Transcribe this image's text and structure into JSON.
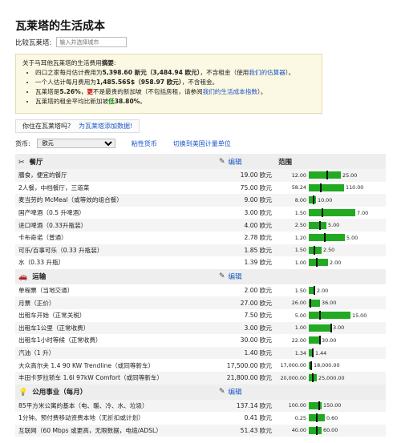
{
  "title": "瓦莱塔的生活成本",
  "compare": {
    "label": "比较瓦莱塔:",
    "placeholder": "输入并选择城市"
  },
  "summary": {
    "intro_a": "关于马耳他瓦莱塔的生活费用",
    "intro_b": "摘要",
    "intro_c": ":",
    "items": [
      {
        "a": "四口之家每月估计费用为",
        "b": "5,398.60 新元（3,484.94 欧元）",
        "c": "，不含租金（使用",
        "d": "我们的估算器",
        "e": "）。"
      },
      {
        "a": "一个人估计每月费用为",
        "b": "1,485.56S$（958.97 欧元）",
        "c": "，不含租金。",
        "d": "",
        "e": ""
      },
      {
        "a": "瓦莱塔是",
        "b": "5.26%",
        "c": "，",
        "d": "更",
        "e": "不是最贵的新加坡（不包括房租，请参阅",
        "f": "我们的生活成本指数",
        "g": "）。"
      },
      {
        "a": "瓦莱塔的租金平均比新加坡",
        "b": "低",
        "c": "38.80%",
        "d": "。"
      }
    ]
  },
  "live": {
    "q": "你住在瓦莱塔吗？",
    "link": "为瓦莱塔添加数据!"
  },
  "currency": {
    "label": "货币:",
    "selected": "欧元",
    "sticky": "粘性货币",
    "switch": "切换到美国计量单位"
  },
  "range_header": "范围",
  "edit_label": "编辑",
  "sections": [
    {
      "key": "restaurants",
      "icon": "✂",
      "title": "餐厅",
      "edit": true,
      "rows": [
        {
          "name": "膳食，便宜的餐厅",
          "price": "19.00 欧元",
          "lo": "12.00",
          "hi": "25.00",
          "w": 40,
          "m": 0.54
        },
        {
          "name": "2人餐，中档餐厅，三道菜",
          "price": "75.00 欧元",
          "lo": "58.24",
          "hi": "110.00",
          "w": 44,
          "m": 0.32
        },
        {
          "name": "麦当劳的 McMeal（或等效的组合餐）",
          "price": "9.00 欧元",
          "lo": "8.00",
          "hi": "10.00",
          "w": 9,
          "m": 0.5
        },
        {
          "name": "国产啤酒（0.5 升啤酒）",
          "price": "3.00 欧元",
          "lo": "1.50",
          "hi": "7.00",
          "w": 58,
          "m": 0.27
        },
        {
          "name": "进口啤酒（0.33升瓶装）",
          "price": "4.00 欧元",
          "lo": "2.50",
          "hi": "5.00",
          "w": 22,
          "m": 0.6
        },
        {
          "name": "卡布奇诺（普通）",
          "price": "2.78 欧元",
          "lo": "1.20",
          "hi": "5.00",
          "w": 45,
          "m": 0.42
        },
        {
          "name": "可乐/百事可乐（0.33 升瓶装）",
          "price": "1.85 欧元",
          "lo": "1.50",
          "hi": "2.50",
          "w": 16,
          "m": 0.35
        },
        {
          "name": "水（0.33 升瓶）",
          "price": "1.39 欧元",
          "lo": "1.00",
          "hi": "2.00",
          "w": 24,
          "m": 0.39
        }
      ]
    },
    {
      "key": "transport",
      "icon": "🚗",
      "title": "运输",
      "edit": true,
      "rows": [
        {
          "name": "单程票（当地交通）",
          "price": "2.00 欧元",
          "lo": "1.50",
          "hi": "2.00",
          "w": 8,
          "m": 0.8
        },
        {
          "name": "月票（正价）",
          "price": "27.00 欧元",
          "lo": "26.00",
          "hi": "36.00",
          "w": 14,
          "m": 0.1
        },
        {
          "name": "出租车开始（正常关税）",
          "price": "7.50 欧元",
          "lo": "5.00",
          "hi": "15.00",
          "w": 52,
          "m": 0.25
        },
        {
          "name": "出租车1公里（正常收费）",
          "price": "3.00 欧元",
          "lo": "1.00",
          "hi": "3.00",
          "w": 28,
          "m": 0.95
        },
        {
          "name": "出租车1小时等候（正常收费）",
          "price": "30.00 欧元",
          "lo": "22.00",
          "hi": "30.00",
          "w": 14,
          "m": 0.95
        },
        {
          "name": "汽油（1 升）",
          "price": "1.40 欧元",
          "lo": "1.34",
          "hi": "1.44",
          "w": 6,
          "m": 0.6
        },
        {
          "name": "大众高尔夫 1.4 90 KW Trendline（或同等新车）",
          "price": "17,500.00 欧元",
          "lo": "17,000.00",
          "hi": "18,000.00",
          "w": 4,
          "m": 0.5
        },
        {
          "name": "丰田卡罗拉轿车 1.6l 97kW Comfort（或同等新车）",
          "price": "21,800.00 欧元",
          "lo": "20,000.00",
          "hi": "25,000.00",
          "w": 10,
          "m": 0.36
        }
      ]
    },
    {
      "key": "utilities",
      "icon": "💡",
      "title": "公用事业（每月）",
      "edit": true,
      "rows": [
        {
          "name": "85平方米公寓的基本（电、暖、冷、水、垃圾）",
          "price": "137.14 欧元",
          "lo": "100.00",
          "hi": "150.00",
          "w": 16,
          "m": 0.74
        },
        {
          "name": "1分钟。预付费移动资费本地（无折扣或计划）",
          "price": "0.41 欧元",
          "lo": "0.25",
          "hi": "0.60",
          "w": 20,
          "m": 0.45
        },
        {
          "name": "互联网（60 Mbps 或更高，无限数据，电缆/ADSL）",
          "price": "51.43 欧元",
          "lo": "40.00",
          "hi": "60.00",
          "w": 16,
          "m": 0.57
        }
      ]
    }
  ]
}
